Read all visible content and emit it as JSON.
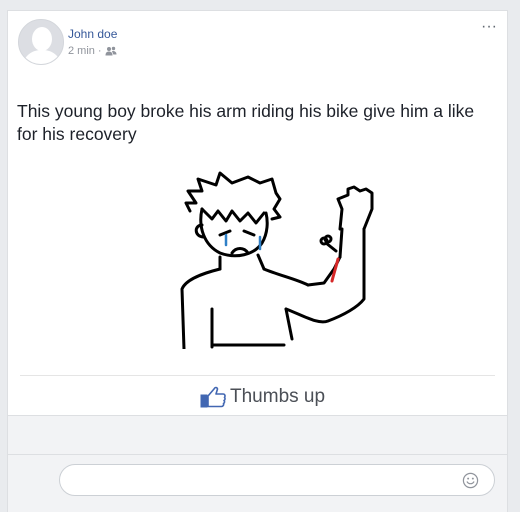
{
  "post": {
    "author": "John doe",
    "time": "2 min",
    "separator": "·",
    "audience_icon": "friends-icon",
    "more_icon": "more-options-icon",
    "more_label": "···",
    "text": "This young boy broke his arm riding his bike give him a like for his recovery"
  },
  "reaction": {
    "icon": "thumbs-up-icon",
    "label": "Thumbs up",
    "accent": "#4267b2"
  },
  "comment": {
    "placeholder": "",
    "emoji_icon": "smiley-icon"
  },
  "colors": {
    "author_link": "#365899",
    "meta": "#90949c",
    "blood": "#d62828"
  }
}
